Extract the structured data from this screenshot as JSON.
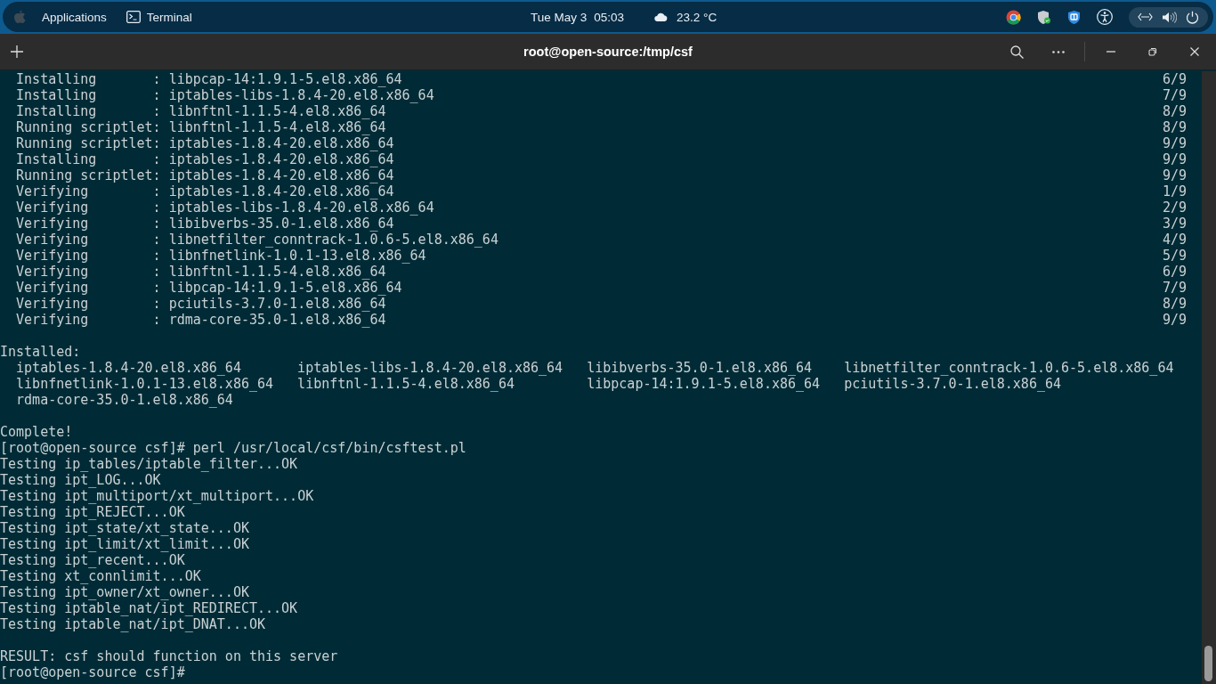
{
  "top_bar": {
    "menu": "Applications",
    "app": "Terminal",
    "date": "Tue May 3",
    "time": "05:03",
    "weather": "23.2 °C"
  },
  "window": {
    "title": "root@open-source:/tmp/csf"
  },
  "terminal": {
    "blocks": [
      {
        "kind": "transaction",
        "rows": [
          {
            "text": "  Installing       : libpcap-14:1.9.1-5.el8.x86_64",
            "step": "6/9"
          },
          {
            "text": "  Installing       : iptables-libs-1.8.4-20.el8.x86_64",
            "step": "7/9"
          },
          {
            "text": "  Installing       : libnftnl-1.1.5-4.el8.x86_64",
            "step": "8/9"
          },
          {
            "text": "  Running scriptlet: libnftnl-1.1.5-4.el8.x86_64",
            "step": "8/9"
          },
          {
            "text": "  Running scriptlet: iptables-1.8.4-20.el8.x86_64",
            "step": "9/9"
          },
          {
            "text": "  Installing       : iptables-1.8.4-20.el8.x86_64",
            "step": "9/9"
          },
          {
            "text": "  Running scriptlet: iptables-1.8.4-20.el8.x86_64",
            "step": "9/9"
          },
          {
            "text": "  Verifying        : iptables-1.8.4-20.el8.x86_64",
            "step": "1/9"
          },
          {
            "text": "  Verifying        : iptables-libs-1.8.4-20.el8.x86_64",
            "step": "2/9"
          },
          {
            "text": "  Verifying        : libibverbs-35.0-1.el8.x86_64",
            "step": "3/9"
          },
          {
            "text": "  Verifying        : libnetfilter_conntrack-1.0.6-5.el8.x86_64",
            "step": "4/9"
          },
          {
            "text": "  Verifying        : libnfnetlink-1.0.1-13.el8.x86_64",
            "step": "5/9"
          },
          {
            "text": "  Verifying        : libnftnl-1.1.5-4.el8.x86_64",
            "step": "6/9"
          },
          {
            "text": "  Verifying        : libpcap-14:1.9.1-5.el8.x86_64",
            "step": "7/9"
          },
          {
            "text": "  Verifying        : pciutils-3.7.0-1.el8.x86_64",
            "step": "8/9"
          },
          {
            "text": "  Verifying        : rdma-core-35.0-1.el8.x86_64",
            "step": "9/9"
          }
        ]
      },
      {
        "kind": "installed",
        "heading": "Installed:",
        "packages": [
          "iptables-1.8.4-20.el8.x86_64",
          "iptables-libs-1.8.4-20.el8.x86_64",
          "libibverbs-35.0-1.el8.x86_64",
          "libnetfilter_conntrack-1.0.6-5.el8.x86_64",
          "libnfnetlink-1.0.1-13.el8.x86_64",
          "libnftnl-1.1.5-4.el8.x86_64",
          "libpcap-14:1.9.1-5.el8.x86_64",
          "pciutils-3.7.0-1.el8.x86_64",
          "rdma-core-35.0-1.el8.x86_64"
        ]
      },
      {
        "kind": "output",
        "lines": [
          "Complete!",
          "[root@open-source csf]# perl /usr/local/csf/bin/csftest.pl",
          "Testing ip_tables/iptable_filter...OK",
          "Testing ipt_LOG...OK",
          "Testing ipt_multiport/xt_multiport...OK",
          "Testing ipt_REJECT...OK",
          "Testing ipt_state/xt_state...OK",
          "Testing ipt_limit/xt_limit...OK",
          "Testing ipt_recent...OK",
          "Testing xt_connlimit...OK",
          "Testing ipt_owner/xt_owner...OK",
          "Testing iptable_nat/ipt_REDIRECT...OK",
          "Testing iptable_nat/ipt_DNAT...OK"
        ]
      },
      {
        "kind": "output",
        "lines": [
          "RESULT: csf should function on this server",
          "[root@open-source csf]#"
        ]
      }
    ]
  }
}
